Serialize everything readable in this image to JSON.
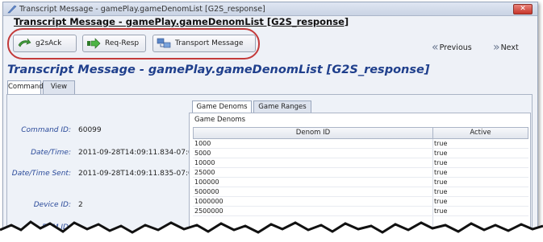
{
  "window": {
    "title": "Transcript Message - gamePlay.gameDenomList [G2S_response]",
    "close_symbol": "✕"
  },
  "header": {
    "title": "Transcript Message - gamePlay.gameDenomList [G2S_response]"
  },
  "toolbar": {
    "buttons": [
      {
        "label": "g2sAck",
        "icon": "arrow-back-icon"
      },
      {
        "label": "Req-Resp",
        "icon": "arrow-right-icon"
      },
      {
        "label": "Transport Message",
        "icon": "transport-icon"
      }
    ],
    "previous_label": "Previous",
    "next_label": "Next",
    "highlight_color": "#c33a3a"
  },
  "main": {
    "title": "Transcript Message - gamePlay.gameDenomList [G2S_response]",
    "title_color": "#1f3f8c",
    "tabs": [
      {
        "label": "Command"
      },
      {
        "label": "View XML"
      }
    ],
    "fields": [
      {
        "label": "Command ID:",
        "value": "60099"
      },
      {
        "label": "Date/Time:",
        "value": "2011-09-28T14:09:11.834-07:00"
      },
      {
        "label": "Date/Time Sent:",
        "value": "2011-09-28T14:09:11.835-07:00"
      },
      {
        "label": "Device ID:",
        "value": "2"
      },
      {
        "label": "EGM ID:",
        "value": ""
      }
    ]
  },
  "denoms": {
    "tabs": [
      {
        "label": "Game Denoms"
      },
      {
        "label": "Game Ranges"
      }
    ],
    "caption": "Game Denoms",
    "columns": [
      "Denom ID",
      "Active"
    ],
    "rows": [
      {
        "id": "1000",
        "active": "true"
      },
      {
        "id": "5000",
        "active": "true"
      },
      {
        "id": "10000",
        "active": "true"
      },
      {
        "id": "25000",
        "active": "true"
      },
      {
        "id": "100000",
        "active": "true"
      },
      {
        "id": "500000",
        "active": "true"
      },
      {
        "id": "1000000",
        "active": "true"
      },
      {
        "id": "2500000",
        "active": "true"
      }
    ]
  }
}
